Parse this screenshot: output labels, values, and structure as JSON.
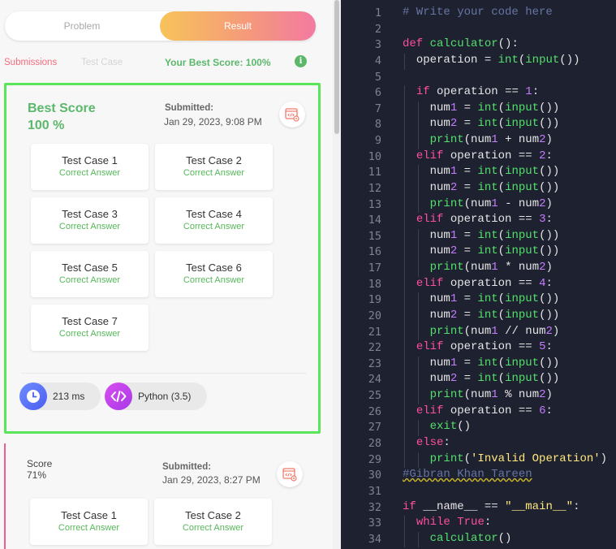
{
  "tabs": {
    "problem": "Problem",
    "result": "Result"
  },
  "subtabs": {
    "submissions": "Submissions",
    "test_case": "Test Case"
  },
  "best_score_header": "Your Best Score: 100%",
  "best_card": {
    "title": "Best Score",
    "score": "100 %",
    "submitted_label": "Submitted:",
    "submitted_date": "Jan 29, 2023, 9:08 PM",
    "test_cases": [
      {
        "name": "Test Case 1",
        "status": "Correct Answer"
      },
      {
        "name": "Test Case 2",
        "status": "Correct Answer"
      },
      {
        "name": "Test Case 3",
        "status": "Correct Answer"
      },
      {
        "name": "Test Case 4",
        "status": "Correct Answer"
      },
      {
        "name": "Test Case 5",
        "status": "Correct Answer"
      },
      {
        "name": "Test Case 6",
        "status": "Correct Answer"
      },
      {
        "name": "Test Case 7",
        "status": "Correct Answer"
      }
    ],
    "runtime": "213 ms",
    "language": "Python (3.5)"
  },
  "second_card": {
    "score_label": "Score",
    "score": "71%",
    "submitted_label": "Submitted:",
    "submitted_date": "Jan 29, 2023, 8:27 PM",
    "test_cases": [
      {
        "name": "Test Case 1",
        "status": "Correct Answer"
      },
      {
        "name": "Test Case 2",
        "status": "Correct Answer"
      }
    ]
  },
  "icons": {
    "info": "info-icon",
    "code_view": "code-view-icon",
    "clock": "clock-icon",
    "language": "code-brackets-icon"
  },
  "colors": {
    "accent_green": "#5bb86b",
    "border_green": "#5ae45a",
    "result_tab_gradient": [
      "#f7c35a",
      "#f37aa1"
    ],
    "editor_bg": "#1e2130",
    "keyword": "#ff4fa0",
    "builtin": "#53e06a",
    "number": "#c77dff",
    "string": "#ffe87c",
    "comment": "#6675a3"
  },
  "editor": {
    "lines": [
      "# Write your code here",
      "",
      "def calculator():",
      "  operation = int(input())",
      "",
      "  if operation == 1:",
      "    num1 = int(input())",
      "    num2 = int(input())",
      "    print(num1 + num2)",
      "  elif operation == 2:",
      "    num1 = int(input())",
      "    num2 = int(input())",
      "    print(num1 - num2)",
      "  elif operation == 3:",
      "    num1 = int(input())",
      "    num2 = int(input())",
      "    print(num1 * num2)",
      "  elif operation == 4:",
      "    num1 = int(input())",
      "    num2 = int(input())",
      "    print(num1 // num2)",
      "  elif operation == 5:",
      "    num1 = int(input())",
      "    num2 = int(input())",
      "    print(num1 % num2)",
      "  elif operation == 6:",
      "    exit()",
      "  else:",
      "    print('Invalid Operation')",
      "#Gibran Khan Tareen",
      "",
      "if __name__ == \"__main__\":",
      "  while True:",
      "    calculator()"
    ]
  }
}
